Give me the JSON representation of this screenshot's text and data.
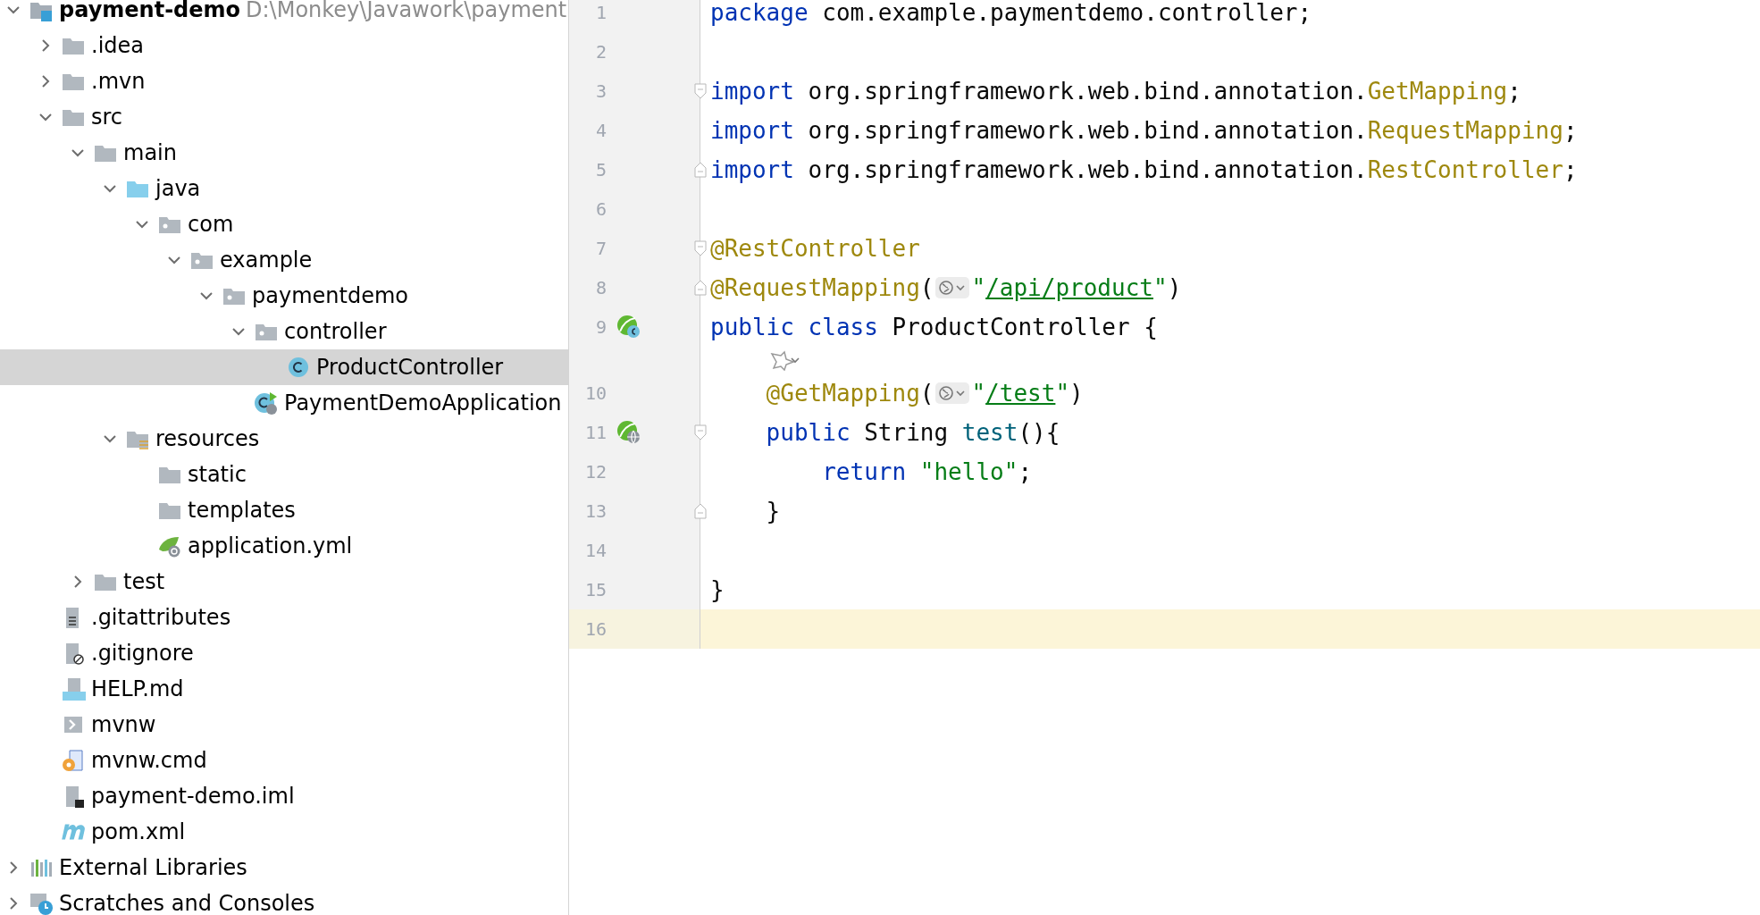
{
  "project_tree": {
    "items": [
      {
        "name": "payment-demo",
        "path": "D:\\Monkey\\Javawork\\payment",
        "kind": "module",
        "expanded": true,
        "selected": false,
        "children": [
          {
            "name": ".idea",
            "kind": "folder",
            "expanded": false,
            "selected": false
          },
          {
            "name": ".mvn",
            "kind": "folder",
            "expanded": false,
            "selected": false
          },
          {
            "name": "src",
            "kind": "folder",
            "expanded": true,
            "selected": false,
            "children": [
              {
                "name": "main",
                "kind": "folder",
                "expanded": true,
                "selected": false,
                "children": [
                  {
                    "name": "java",
                    "kind": "source-folder",
                    "expanded": true,
                    "selected": false,
                    "children": [
                      {
                        "name": "com",
                        "kind": "package",
                        "expanded": true,
                        "selected": false,
                        "children": [
                          {
                            "name": "example",
                            "kind": "package",
                            "expanded": true,
                            "selected": false,
                            "children": [
                              {
                                "name": "paymentdemo",
                                "kind": "package",
                                "expanded": true,
                                "selected": false,
                                "children": [
                                  {
                                    "name": "controller",
                                    "kind": "package",
                                    "expanded": true,
                                    "selected": false,
                                    "children": [
                                      {
                                        "name": "ProductController",
                                        "kind": "class",
                                        "selected": true
                                      }
                                    ]
                                  },
                                  {
                                    "name": "PaymentDemoApplication",
                                    "kind": "spring-app",
                                    "selected": false
                                  }
                                ]
                              }
                            ]
                          }
                        ]
                      }
                    ]
                  },
                  {
                    "name": "resources",
                    "kind": "resources",
                    "expanded": true,
                    "selected": false,
                    "children": [
                      {
                        "name": "static",
                        "kind": "folder",
                        "selected": false
                      },
                      {
                        "name": "templates",
                        "kind": "folder",
                        "selected": false
                      },
                      {
                        "name": "application.yml",
                        "kind": "spring-config",
                        "selected": false
                      }
                    ]
                  }
                ]
              },
              {
                "name": "test",
                "kind": "folder",
                "expanded": false,
                "selected": false
              }
            ]
          },
          {
            "name": ".gitattributes",
            "kind": "text-file",
            "selected": false
          },
          {
            "name": ".gitignore",
            "kind": "ignore-file",
            "selected": false
          },
          {
            "name": "HELP.md",
            "kind": "markdown",
            "selected": false
          },
          {
            "name": "mvnw",
            "kind": "shell",
            "selected": false
          },
          {
            "name": "mvnw.cmd",
            "kind": "cmd",
            "selected": false
          },
          {
            "name": "payment-demo.iml",
            "kind": "iml",
            "selected": false
          },
          {
            "name": "pom.xml",
            "kind": "maven",
            "selected": false
          }
        ]
      },
      {
        "name": "External Libraries",
        "kind": "libraries",
        "expanded": false,
        "selected": false
      },
      {
        "name": "Scratches and Consoles",
        "kind": "scratches",
        "expanded": false,
        "selected": false
      }
    ]
  },
  "editor": {
    "lines": [
      {
        "kind": "code",
        "number": "1",
        "current": false,
        "tokens": [
          {
            "kind": "keyword",
            "text": "package"
          },
          {
            "kind": "plain",
            "text": " com.example.paymentdemo.controller;"
          }
        ]
      },
      {
        "kind": "code",
        "number": "2",
        "current": false
      },
      {
        "kind": "code",
        "number": "3",
        "current": false,
        "markers": [
          {
            "kind": "fold-start"
          }
        ],
        "tokens": [
          {
            "kind": "keyword",
            "text": "import"
          },
          {
            "kind": "plain",
            "text": " org.springframework.web.bind.annotation."
          },
          {
            "kind": "annotation",
            "text": "GetMapping"
          },
          {
            "kind": "plain",
            "text": ";"
          }
        ]
      },
      {
        "kind": "code",
        "number": "4",
        "current": false,
        "tokens": [
          {
            "kind": "keyword",
            "text": "import"
          },
          {
            "kind": "plain",
            "text": " org.springframework.web.bind.annotation."
          },
          {
            "kind": "annotation",
            "text": "RequestMapping"
          },
          {
            "kind": "plain",
            "text": ";"
          }
        ]
      },
      {
        "kind": "code",
        "number": "5",
        "current": false,
        "markers": [
          {
            "kind": "fold-end"
          }
        ],
        "tokens": [
          {
            "kind": "keyword",
            "text": "import"
          },
          {
            "kind": "plain",
            "text": " org.springframework.web.bind.annotation."
          },
          {
            "kind": "annotation",
            "text": "RestController"
          },
          {
            "kind": "plain",
            "text": ";"
          }
        ]
      },
      {
        "kind": "code",
        "number": "6",
        "current": false
      },
      {
        "kind": "code",
        "number": "7",
        "current": false,
        "markers": [
          {
            "kind": "fold-start"
          }
        ],
        "tokens": [
          {
            "kind": "annotation",
            "text": "@RestController"
          }
        ]
      },
      {
        "kind": "code",
        "number": "8",
        "current": false,
        "markers": [
          {
            "kind": "fold-end"
          }
        ],
        "tokens": [
          {
            "kind": "annotation",
            "text": "@RequestMapping"
          },
          {
            "kind": "plain",
            "text": "("
          },
          {
            "kind": "globe"
          },
          {
            "kind": "string",
            "text": "\""
          },
          {
            "kind": "url",
            "text": "/api/product"
          },
          {
            "kind": "string",
            "text": "\""
          },
          {
            "kind": "plain",
            "text": ")"
          }
        ]
      },
      {
        "kind": "code",
        "number": "9",
        "current": false,
        "markers": [
          {
            "kind": "bean"
          }
        ],
        "tokens": [
          {
            "kind": "keyword",
            "text": "public class"
          },
          {
            "kind": "plain",
            "text": " ProductController {"
          }
        ]
      },
      {
        "kind": "inlay",
        "tokens": [
          {
            "kind": "indent"
          },
          {
            "kind": "ai-hint"
          }
        ]
      },
      {
        "kind": "code",
        "number": "10",
        "current": false,
        "tokens": [
          {
            "kind": "indent"
          },
          {
            "kind": "annotation",
            "text": "@GetMapping"
          },
          {
            "kind": "plain",
            "text": "("
          },
          {
            "kind": "globe"
          },
          {
            "kind": "string",
            "text": "\""
          },
          {
            "kind": "url",
            "text": "/test"
          },
          {
            "kind": "string",
            "text": "\""
          },
          {
            "kind": "plain",
            "text": ")"
          }
        ]
      },
      {
        "kind": "code",
        "number": "11",
        "current": false,
        "markers": [
          {
            "kind": "endpoint"
          },
          {
            "kind": "fold-start"
          }
        ],
        "tokens": [
          {
            "kind": "indent"
          },
          {
            "kind": "keyword",
            "text": "public"
          },
          {
            "kind": "plain",
            "text": " String "
          },
          {
            "kind": "method",
            "text": "test"
          },
          {
            "kind": "plain",
            "text": "(){"
          }
        ]
      },
      {
        "kind": "code",
        "number": "12",
        "current": false,
        "tokens": [
          {
            "kind": "indent"
          },
          {
            "kind": "indent"
          },
          {
            "kind": "keyword",
            "text": "return"
          },
          {
            "kind": "string",
            "text": " \"hello\""
          },
          {
            "kind": "plain",
            "text": ";"
          }
        ]
      },
      {
        "kind": "code",
        "number": "13",
        "current": false,
        "markers": [
          {
            "kind": "fold-end"
          }
        ],
        "tokens": [
          {
            "kind": "indent"
          },
          {
            "kind": "plain",
            "text": "}"
          }
        ]
      },
      {
        "kind": "code",
        "number": "14",
        "current": false
      },
      {
        "kind": "code",
        "number": "15",
        "current": false,
        "tokens": [
          {
            "kind": "plain",
            "text": "}"
          }
        ]
      },
      {
        "kind": "code",
        "number": "16",
        "current": true
      }
    ]
  }
}
